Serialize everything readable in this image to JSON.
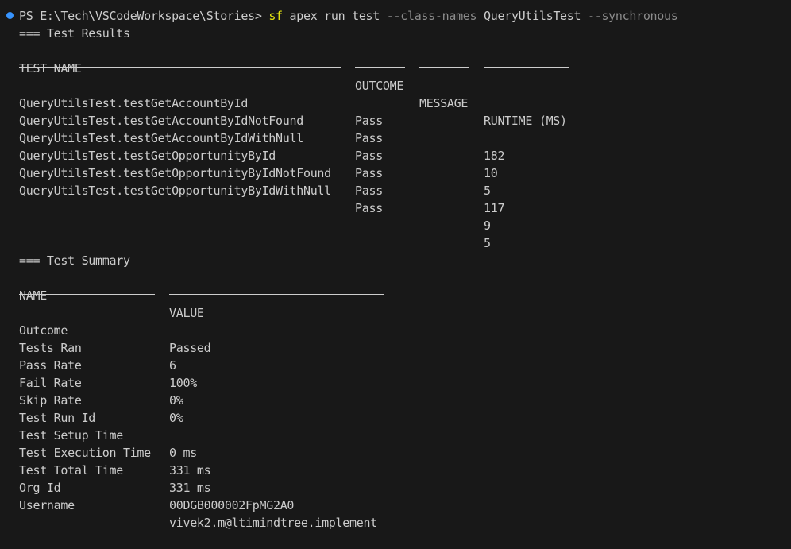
{
  "prompt": {
    "ps": "PS E:\\Tech\\VSCodeWorkspace\\Stories>",
    "cmd_sf": "sf",
    "cmd_args": "apex run test",
    "opt_class": "--class-names",
    "class_value": "QueryUtilsTest",
    "opt_sync": "--synchronous"
  },
  "results": {
    "heading": "=== Test Results",
    "headers": {
      "name": "TEST NAME",
      "outcome": "OUTCOME",
      "message": "MESSAGE",
      "runtime": "RUNTIME (MS)"
    },
    "rows": [
      {
        "name": "QueryUtilsTest.testGetAccountById",
        "outcome": "Pass",
        "message": "",
        "runtime": "182"
      },
      {
        "name": "QueryUtilsTest.testGetAccountByIdNotFound",
        "outcome": "Pass",
        "message": "",
        "runtime": "10"
      },
      {
        "name": "QueryUtilsTest.testGetAccountByIdWithNull",
        "outcome": "Pass",
        "message": "",
        "runtime": "5"
      },
      {
        "name": "QueryUtilsTest.testGetOpportunityById",
        "outcome": "Pass",
        "message": "",
        "runtime": "117"
      },
      {
        "name": "QueryUtilsTest.testGetOpportunityByIdNotFound",
        "outcome": "Pass",
        "message": "",
        "runtime": "9"
      },
      {
        "name": "QueryUtilsTest.testGetOpportunityByIdWithNull",
        "outcome": "Pass",
        "message": "",
        "runtime": "5"
      }
    ]
  },
  "summary": {
    "heading": "=== Test Summary",
    "headers": {
      "name": "NAME",
      "value": "VALUE"
    },
    "rows": [
      {
        "name": "Outcome",
        "value": "Passed"
      },
      {
        "name": "Tests Ran",
        "value": "6"
      },
      {
        "name": "Pass Rate",
        "value": "100%"
      },
      {
        "name": "Fail Rate",
        "value": "0%"
      },
      {
        "name": "Skip Rate",
        "value": "0%"
      },
      {
        "name": "Test Run Id",
        "value": ""
      },
      {
        "name": "Test Setup Time",
        "value": "0 ms"
      },
      {
        "name": "Test Execution Time",
        "value": "331 ms"
      },
      {
        "name": "Test Total Time",
        "value": "331 ms"
      },
      {
        "name": "Org Id",
        "value": "00DGB000002FpMG2A0"
      },
      {
        "name": "Username",
        "value": "vivek2.m@ltimindtree.implement"
      }
    ]
  },
  "colors": {
    "background": "#181818",
    "text": "#cccccc",
    "command": "#e5e510",
    "option": "#8c8c8c",
    "status_dot": "#3794ff"
  }
}
